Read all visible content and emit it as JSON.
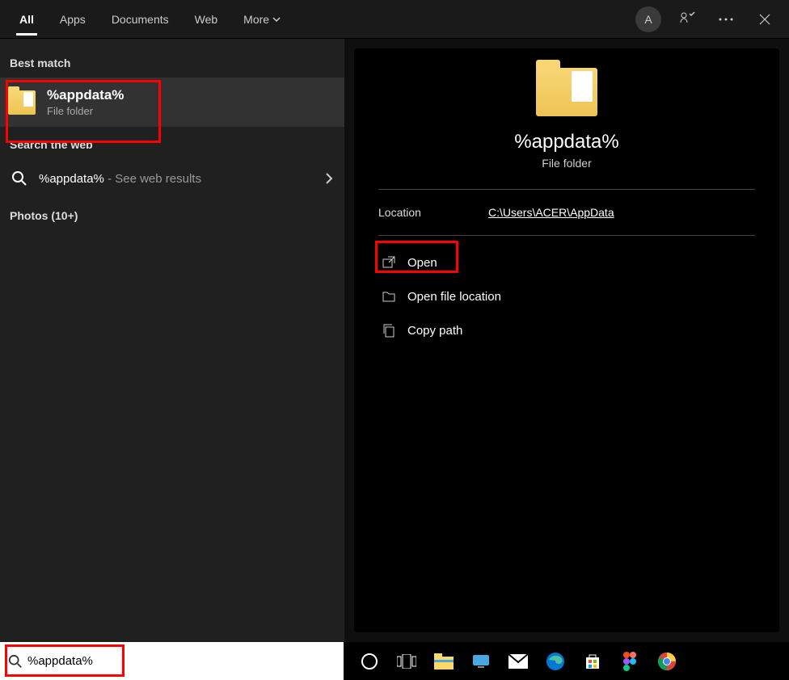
{
  "tabs": {
    "all": "All",
    "apps": "Apps",
    "documents": "Documents",
    "web": "Web",
    "more": "More"
  },
  "avatar_letter": "A",
  "sections": {
    "best_match": "Best match",
    "search_web": "Search the web",
    "photos": "Photos (10+)"
  },
  "best_match": {
    "title": "%appdata%",
    "subtitle": "File folder"
  },
  "web_result": {
    "query": "%appdata%",
    "suffix": " - See web results"
  },
  "preview": {
    "title": "%appdata%",
    "subtitle": "File folder",
    "location_label": "Location",
    "location_value": "C:\\Users\\ACER\\AppData"
  },
  "actions": {
    "open": "Open",
    "open_location": "Open file location",
    "copy_path": "Copy path"
  },
  "search_input": "%appdata%"
}
